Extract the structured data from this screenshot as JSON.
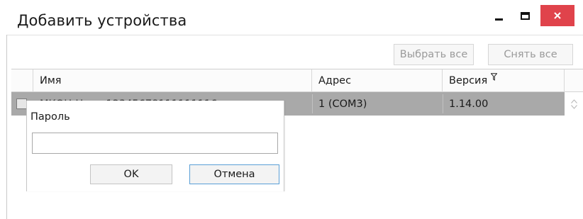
{
  "window": {
    "title": "Добавить устройства",
    "controls": {
      "minimize": "minimize-icon",
      "maximize": "maximize-icon",
      "close": "close-icon"
    },
    "accent_close": "#e0434b"
  },
  "toolbar": {
    "select_all_label": "Выбрать все",
    "clear_all_label": "Снять все"
  },
  "grid": {
    "columns": [
      {
        "label": "Имя"
      },
      {
        "label": "Адрес"
      },
      {
        "label": "Версия",
        "icon": "filter-icon"
      }
    ],
    "rows": [
      {
        "checked": false,
        "name": "МКОН-Н...... 12345678111111116",
        "address": "1 (COM3)",
        "version": "1.14.00"
      }
    ],
    "selected_row_color": "#a9a9a9"
  },
  "password_dialog": {
    "label": "Пароль",
    "value": "",
    "ok_label": "OK",
    "cancel_label": "Отмена"
  }
}
